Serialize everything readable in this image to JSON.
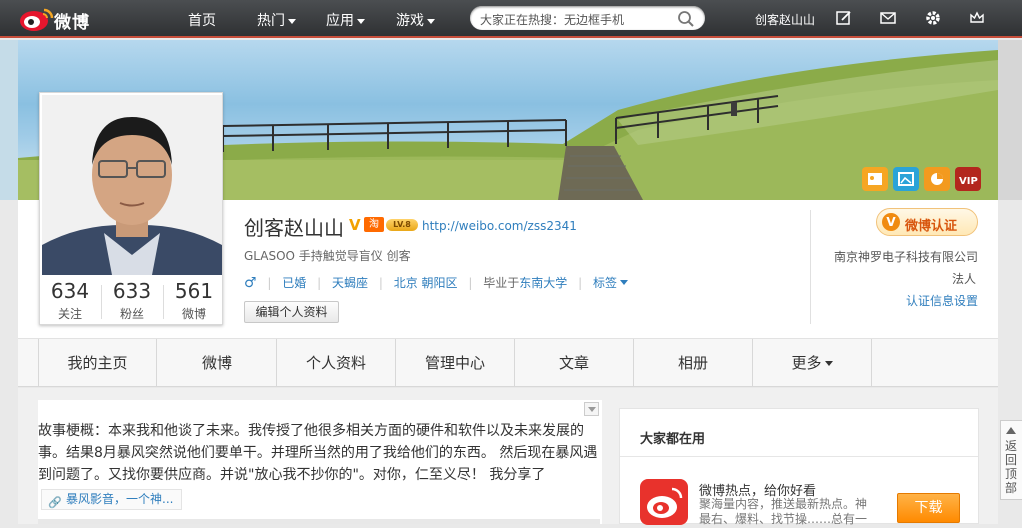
{
  "topbar": {
    "logo_text": "微博",
    "nav": [
      {
        "label": "首页",
        "caret": false
      },
      {
        "label": "热门",
        "caret": true
      },
      {
        "label": "应用",
        "caret": true
      },
      {
        "label": "游戏",
        "caret": true
      }
    ],
    "search_text": "大家正在热搜：无边框手机",
    "username": "创客赵山山",
    "icons": [
      "compose-icon",
      "mail-icon",
      "gear-icon",
      "crown-icon"
    ]
  },
  "profile": {
    "name": "创客赵山山",
    "verify_mark": "V",
    "taobao_label": "淘",
    "level_label": "LV.8",
    "url": "http://weibo.com/zss2341",
    "intro": "GLASOO 手持触觉导盲仪 创客",
    "gender_symbol": "♂",
    "relationship": "已婚",
    "zodiac": "天蝎座",
    "location": "北京 朝阳区",
    "school_prefix": "毕业于",
    "school": "东南大学",
    "tags_label": "标签",
    "edit_button": "编辑个人资料",
    "stats": [
      {
        "value": "634",
        "label": "关注"
      },
      {
        "value": "633",
        "label": "粉丝"
      },
      {
        "value": "561",
        "label": "微博"
      }
    ],
    "verify": {
      "badge_mark": "V",
      "badge_label": "微博认证",
      "company": "南京神罗电子科技有限公司",
      "role": "法人",
      "settings_link": "认证信息设置"
    }
  },
  "tabs": [
    "我的主页",
    "微博",
    "个人资料",
    "管理中心",
    "文章",
    "相册",
    "更多"
  ],
  "feed": {
    "text": "故事梗概：本来我和他谈了未来。我传授了他很多相关方面的硬件和软件以及未来发展的事。结果8月暴风突然说他们要单干。并理所当然的用了我给他们的东西。 然后现在暴风遇到问题了。又找你要供应商。并说\"放心我不抄你的\"。对你，仁至义尽！ 我分享了",
    "link_label": "暴风影音，一个神..."
  },
  "sidebar": {
    "title": "大家都在用",
    "app_name": "微博热点，给你好看",
    "app_desc": "聚海量内容，推送最新热点。神最右、爆料、找节操……总有一",
    "download": "下载"
  },
  "back_top": {
    "label": "返回顶部"
  },
  "colors": {
    "accent_red": "#c64d3a",
    "link_blue": "#2f7ebd",
    "orange": "#ff8a00"
  }
}
